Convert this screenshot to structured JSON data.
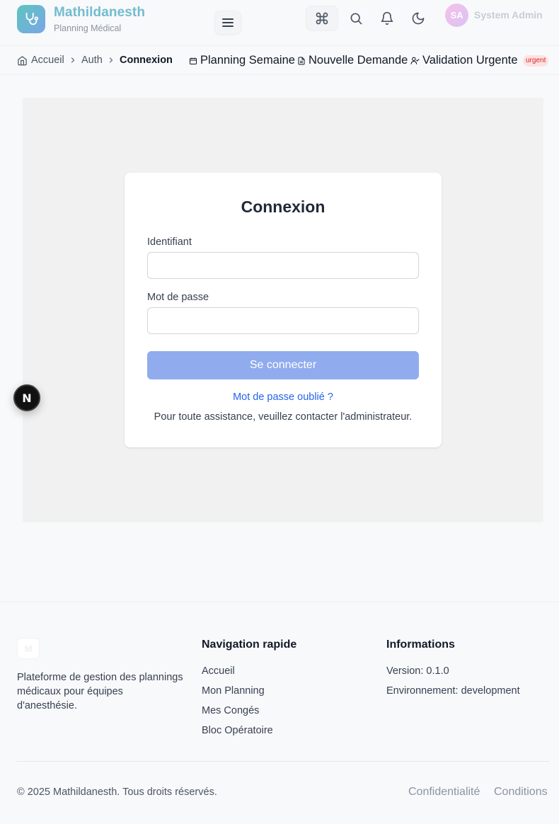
{
  "header": {
    "brand_name": "Mathildanesth",
    "brand_sub": "Planning Médical",
    "user_initials": "SA",
    "user_name": "System Admin"
  },
  "icons": {
    "logo": "stethoscope-icon",
    "menu": "hamburger-menu-icon",
    "command": "command-key-icon",
    "search": "search-icon",
    "notifications": "bell-icon",
    "theme": "moon-icon"
  },
  "breadcrumb": {
    "items": [
      "Accueil",
      "Auth",
      "Connexion"
    ]
  },
  "quick_links": [
    {
      "label": "Planning Semaine",
      "icon": "calendar-icon"
    },
    {
      "label": "Nouvelle Demande",
      "icon": "document-icon"
    },
    {
      "label": "Validation Urgente",
      "icon": "user-check-icon",
      "badge": "urgent"
    }
  ],
  "login": {
    "title": "Connexion",
    "username_label": "Identifiant",
    "username_value": "",
    "password_label": "Mot de passe",
    "password_value": "",
    "submit_label": "Se connecter",
    "forgot_link": "Mot de passe oublié ?",
    "help_text": "Pour toute assistance, veuillez contacter l'administrateur."
  },
  "fab_letter": "N",
  "footer": {
    "logo_letter": "M",
    "description": "Plateforme de gestion des plannings médicaux pour équipes d'anesthésie.",
    "nav_title": "Navigation rapide",
    "nav_links": [
      "Accueil",
      "Mon Planning",
      "Mes Congés",
      "Bloc Opératoire"
    ],
    "info_title": "Informations",
    "info_lines": [
      "Version: 0.1.0",
      "Environnement: development"
    ],
    "copyright": "© 2025 Mathildanesth. Tous droits réservés.",
    "legal_links": [
      "Confidentialité",
      "Conditions"
    ]
  },
  "colors": {
    "brand_text": "#72bccf",
    "primary_button": "#90acef",
    "link": "#2563eb",
    "urgent_badge_bg": "#fde2e2",
    "urgent_badge_text": "#dc2626"
  }
}
